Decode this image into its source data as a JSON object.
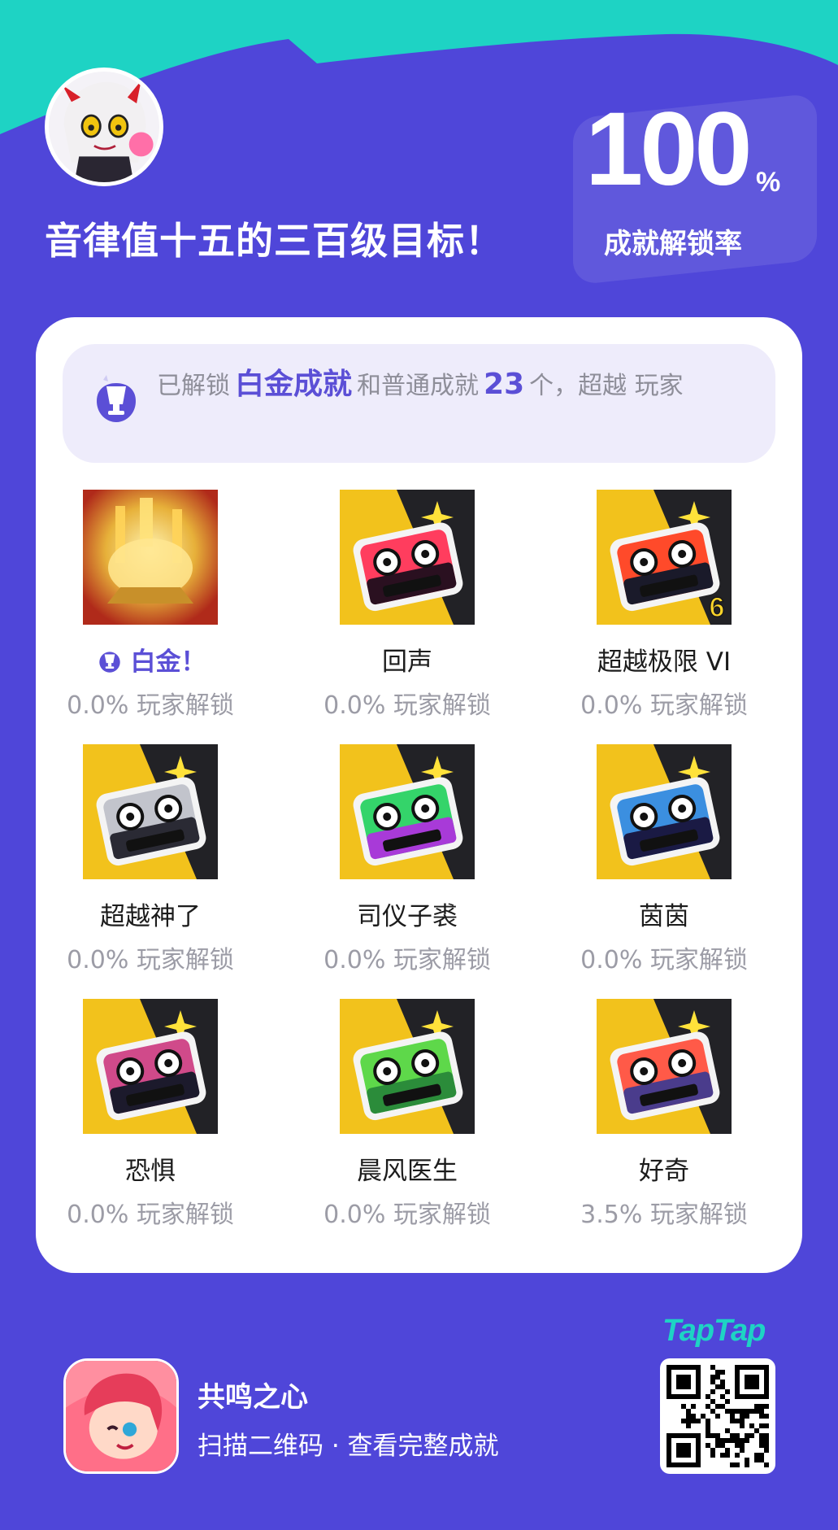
{
  "header": {
    "username": "音律值十五的三百级目标！",
    "rate_value": "100",
    "rate_unit": "%",
    "rate_label": "成就解锁率",
    "avatar_icon": "user-avatar-icon"
  },
  "summary": {
    "prefix": "已解锁",
    "platinum_label": "白金成就",
    "middle": "和普通成就",
    "count": "23",
    "suffix": "个，超越  玩家",
    "icon": "trophy-icon"
  },
  "achievements": [
    {
      "name": "白金！",
      "percent": "0.0% 玩家解锁",
      "platinum": true,
      "colors": [
        "#e7b13a",
        "#b02a1a"
      ]
    },
    {
      "name": "回声",
      "percent": "0.0% 玩家解锁",
      "colors": [
        "#ff3d5e",
        "#2a1020"
      ]
    },
    {
      "name": "超越极限 VI",
      "percent": "0.0% 玩家解锁",
      "badge": "6",
      "colors": [
        "#ff4a2a",
        "#1a1a2a"
      ]
    },
    {
      "name": "超越神了",
      "percent": "0.0% 玩家解锁",
      "colors": [
        "#c2c4cc",
        "#2a2a34"
      ]
    },
    {
      "name": "司仪子裘",
      "percent": "0.0% 玩家解锁",
      "colors": [
        "#34d46a",
        "#a83ad8"
      ]
    },
    {
      "name": "茵茵",
      "percent": "0.0% 玩家解锁",
      "colors": [
        "#3b8fe0",
        "#1a1a44"
      ]
    },
    {
      "name": "恐惧",
      "percent": "0.0% 玩家解锁",
      "colors": [
        "#d04a8a",
        "#1c1a2c"
      ]
    },
    {
      "name": "晨风医生",
      "percent": "0.0% 玩家解锁",
      "colors": [
        "#5ed84a",
        "#2b8c3a"
      ]
    },
    {
      "name": "好奇",
      "percent": "3.5% 玩家解锁",
      "colors": [
        "#ff5a48",
        "#4a3c8c"
      ]
    }
  ],
  "footer": {
    "game_name": "共鸣之心",
    "scan_label": "扫描二维码 · 查看完整成就",
    "brand": "TapTap",
    "game_icon": "game-icon",
    "qr_icon": "qr-code-icon"
  },
  "colors": {
    "background": "#4f46d9",
    "teal": "#1ed3c4",
    "accent": "#5b4fd6"
  }
}
